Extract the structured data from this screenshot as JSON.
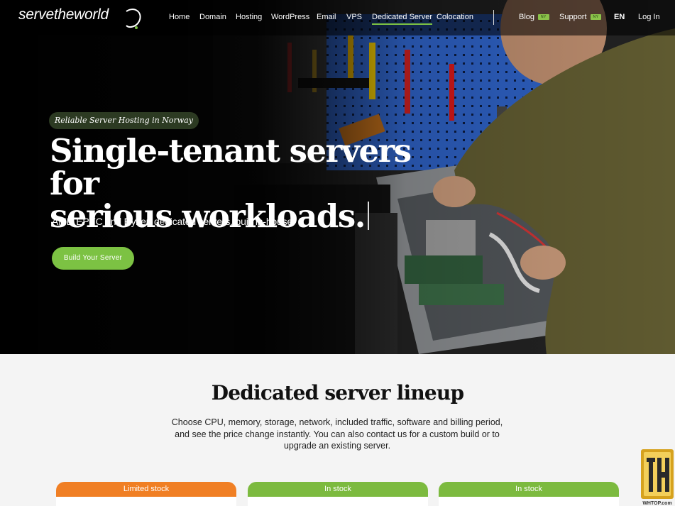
{
  "nav": {
    "logo": "servetheworld",
    "items": [
      "Home",
      "Domain",
      "Hosting",
      "WordPress",
      "Email",
      "VPS",
      "Dedicated Server",
      "Colocation"
    ],
    "active": "Dedicated Server",
    "blog": "Blog",
    "support": "Support",
    "new_badge": "NY",
    "lang": "EN",
    "login": "Log In"
  },
  "hero": {
    "tagline": "Reliable Server Hosting in Norway",
    "headline_line1": "Single-tenant servers for",
    "headline_line2": "serious workloads.",
    "subhead": "AMD EPYC and Ryzen dedicated servers, built in-house",
    "cta": "Build Your Server"
  },
  "lineup": {
    "title": "Dedicated server lineup",
    "description": "Choose CPU, memory, storage, network, included traffic, software and billing period, and see the price change instantly. You can also contact us for a custom build or to upgrade an existing server.",
    "cards": [
      {
        "status": "Limited stock",
        "color": "#f07f24"
      },
      {
        "status": "In stock",
        "color": "#7cba3f"
      },
      {
        "status": "In stock",
        "color": "#7cba3f"
      }
    ]
  },
  "watermark": {
    "text": "WHTOP.com"
  },
  "colors": {
    "accent": "#7cc243",
    "nav_bg": "#000000",
    "page_bg": "#f4f4f4"
  }
}
